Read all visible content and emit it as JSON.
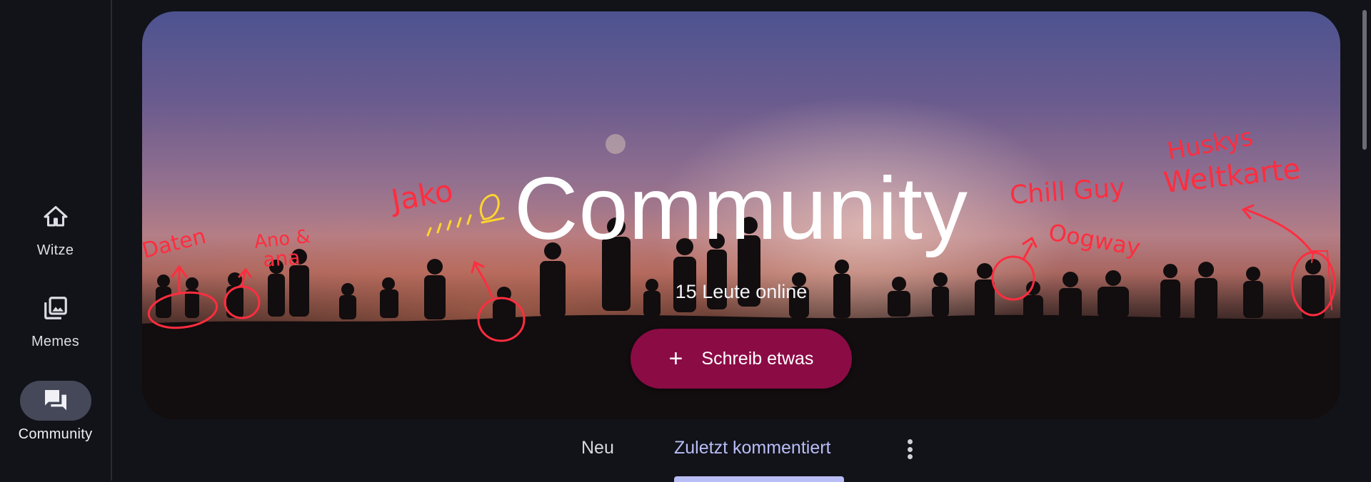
{
  "sidebar": {
    "items": [
      {
        "label": "Witze",
        "icon": "home-icon",
        "active": false
      },
      {
        "label": "Memes",
        "icon": "image-gallery-icon",
        "active": false
      },
      {
        "label": "Community",
        "icon": "forum-icon",
        "active": true
      }
    ]
  },
  "hero": {
    "title": "Community",
    "subtitle": "15 Leute online",
    "write_button": {
      "label": "Schreib etwas",
      "icon": "plus-icon"
    }
  },
  "annotations": {
    "daten": "Daten",
    "ano_ana": [
      "Ano &",
      "ana"
    ],
    "jako": "Jako",
    "chill_guy": "Chill Guy",
    "oogway": "Oogway",
    "huskys": [
      "Huskys",
      "Weltkarte"
    ]
  },
  "tabs": {
    "items": [
      "Neu",
      "Zuletzt kommentiert"
    ],
    "selected": "Zuletzt kommentiert",
    "more_icon": "more-vert-icon"
  },
  "colors": {
    "background": "#121319",
    "accent_button": "#8b0b45",
    "tab_active": "#b9bdf5",
    "rail_active_pill": "#454858",
    "annotation_red": "#ff2d3f",
    "annotation_yellow": "#ffd52e"
  }
}
